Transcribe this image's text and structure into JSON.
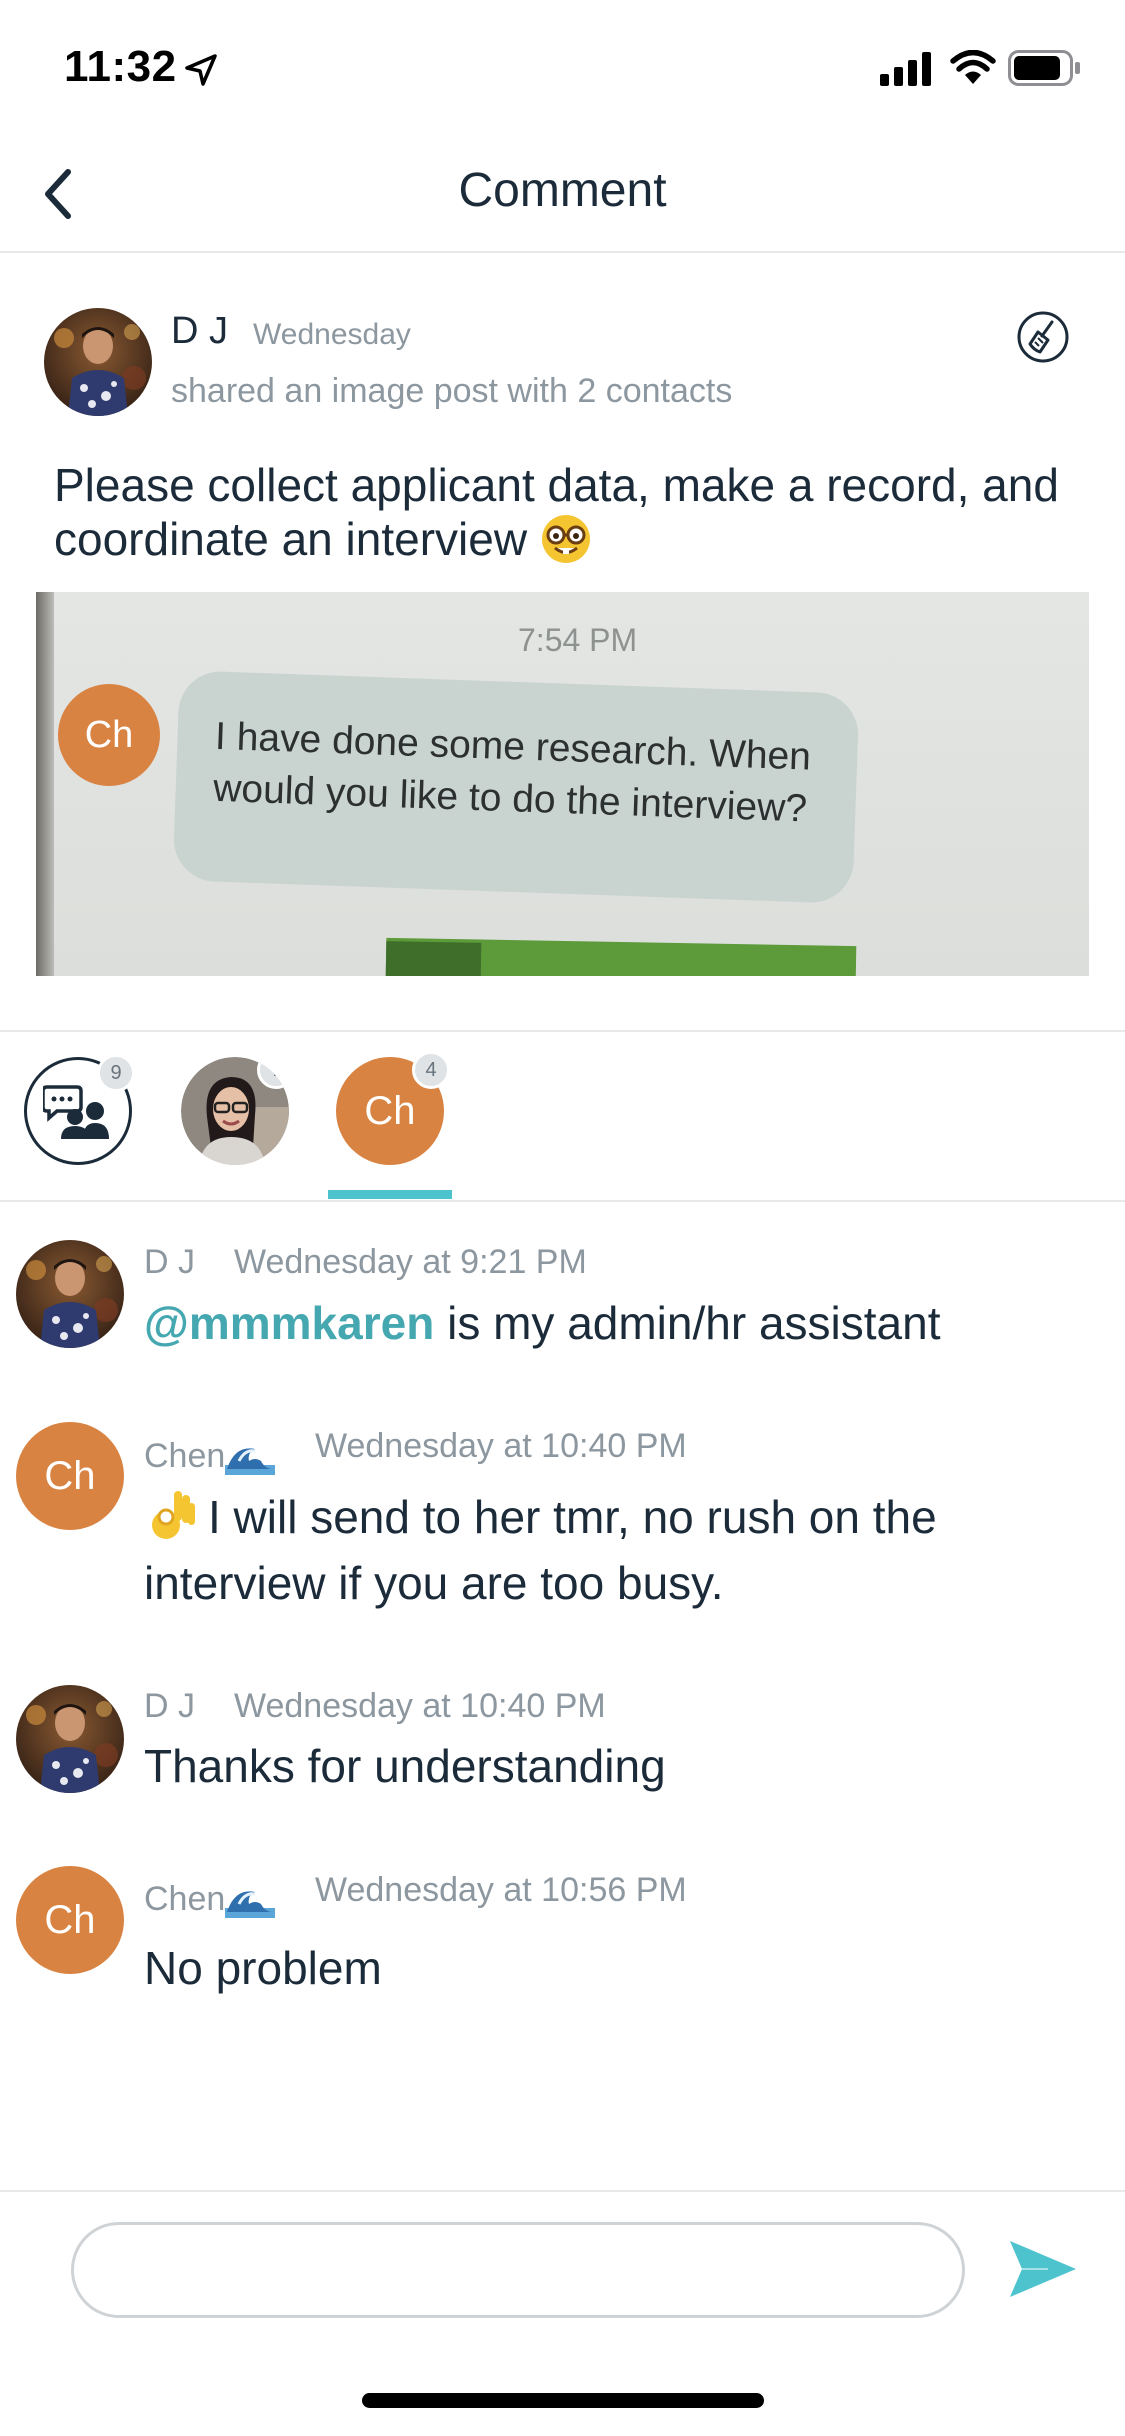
{
  "status_bar": {
    "time": "11:32"
  },
  "nav": {
    "title": "Comment"
  },
  "post": {
    "author": "D J",
    "time": "Wednesday",
    "subtitle": "shared an image post with 2 contacts",
    "text": "Please collect applicant data, make a record, and coordinate an interview",
    "image": {
      "time": "7:54 PM",
      "avatar_initials": "Ch",
      "bubble_text": "I have done some research. When would you like to do the interview?"
    }
  },
  "tabs": [
    {
      "name": "all",
      "icon": "chat-group-icon",
      "badge": "9"
    },
    {
      "name": "karen",
      "icon": "avatar-photo",
      "badge": "7"
    },
    {
      "name": "chen",
      "initials": "Ch",
      "badge": "4",
      "selected": true
    }
  ],
  "comments": [
    {
      "author": "D J",
      "time": "Wednesday at 9:21 PM",
      "mention": "@mmmkaren",
      "text": " is my admin/hr assistant"
    },
    {
      "author": "Chen",
      "initials": "Ch",
      "time": "Wednesday at 10:40 PM",
      "text": "I will send to her tmr, no rush on the interview if you are too busy."
    },
    {
      "author": "D J",
      "time": "Wednesday at 10:40 PM",
      "text": "Thanks for understanding"
    },
    {
      "author": "Chen",
      "initials": "Ch",
      "time": "Wednesday at 10:56 PM",
      "text": "No problem"
    }
  ],
  "input": {
    "value": "",
    "placeholder": ""
  },
  "colors": {
    "accent": "#4dc3cd",
    "mention": "#45a8b1",
    "avatar_orange": "#d98342",
    "text_primary": "#1b2b3a",
    "text_secondary": "#8c979f"
  }
}
